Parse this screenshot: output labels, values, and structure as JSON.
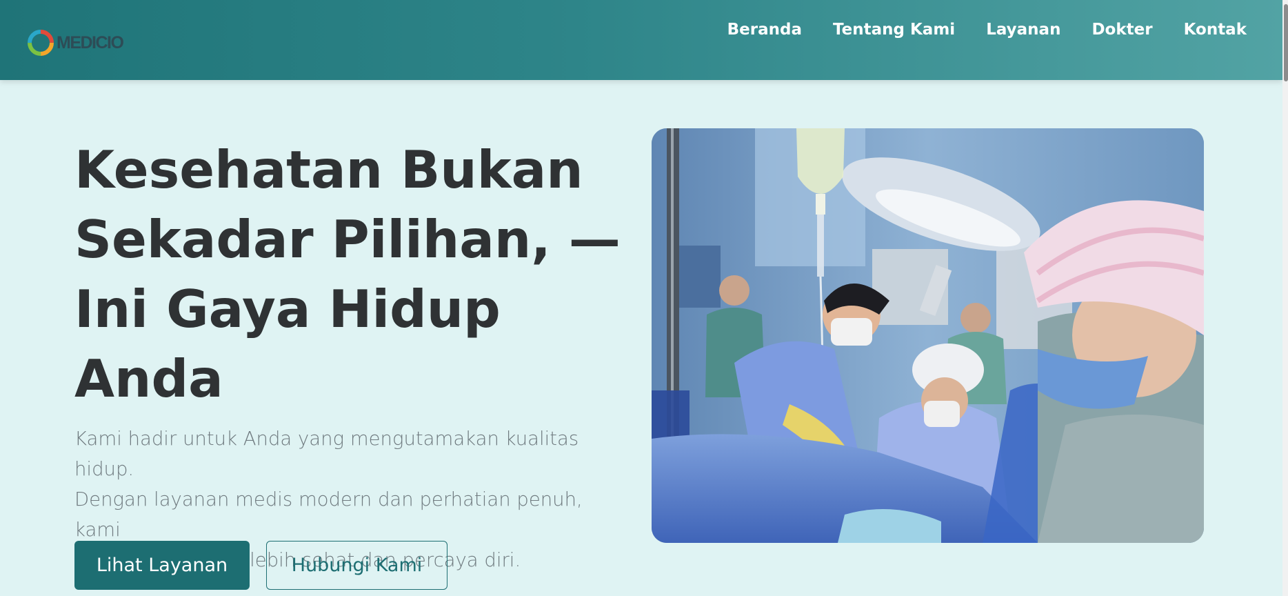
{
  "header": {
    "logo_text": "MEDICIO",
    "logo_icon": "ring-logo-icon",
    "nav": [
      "Beranda",
      "Tentang Kami",
      "Layanan",
      "Dokter",
      "Kontak"
    ]
  },
  "hero": {
    "title_lines": [
      "Kesehatan Bukan",
      "Sekadar Pilihan, —",
      "Ini Gaya Hidup",
      "Anda"
    ],
    "description_lines": [
      "Kami hadir untuk Anda yang mengutamakan kualitas hidup.",
      "Dengan layanan medis modern dan perhatian penuh, kami",
      "bantu Anda hidup lebih sehat dan percaya diri."
    ],
    "primary_button": "Lihat Layanan",
    "secondary_button": "Hubungi Kami",
    "image_subject": "surgery-photo"
  },
  "colors": {
    "page_background": "#dff3f3",
    "header_gradient_start": "#1f7478",
    "header_gradient_end": "#52a3a4",
    "primary": "#1d6e72",
    "title_text": "#2f3234",
    "body_text": "#6f7a7f"
  }
}
